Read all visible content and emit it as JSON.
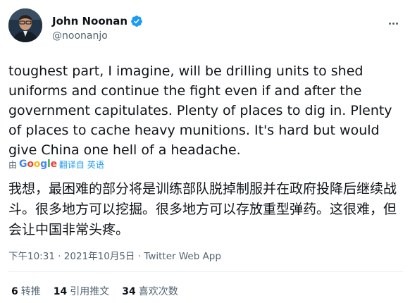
{
  "author": {
    "name": "John Noonan",
    "handle": "@noonanjo"
  },
  "tweet": {
    "text": "toughest part, I imagine, will be drilling units to shed uniforms and continue the fight even if and after the government capitulates. Plenty of places to dig in. Plenty of places to cache heavy munitions. It's hard but would give China one hell of a headache.",
    "translated_by_prefix": "由",
    "translate_link": "翻译自 英语",
    "translation": "我想，最困难的部分将是训练部队脱掉制服并在政府投降后继续战斗。很多地方可以挖掘。很多地方可以存放重型弹药。这很难，但会让中国非常头疼。"
  },
  "meta": {
    "time": "下午10:31",
    "separator": "·",
    "date": "2021年10月5日",
    "source": "Twitter Web App"
  },
  "stats": {
    "retweets_count": "6",
    "retweets_label": "转推",
    "quotes_count": "14",
    "quotes_label": "引用推文",
    "likes_count": "34",
    "likes_label": "喜欢次数"
  },
  "colors": {
    "accent": "#1d9bf0",
    "secondary_text": "#536471",
    "divider": "#eff3f4"
  }
}
